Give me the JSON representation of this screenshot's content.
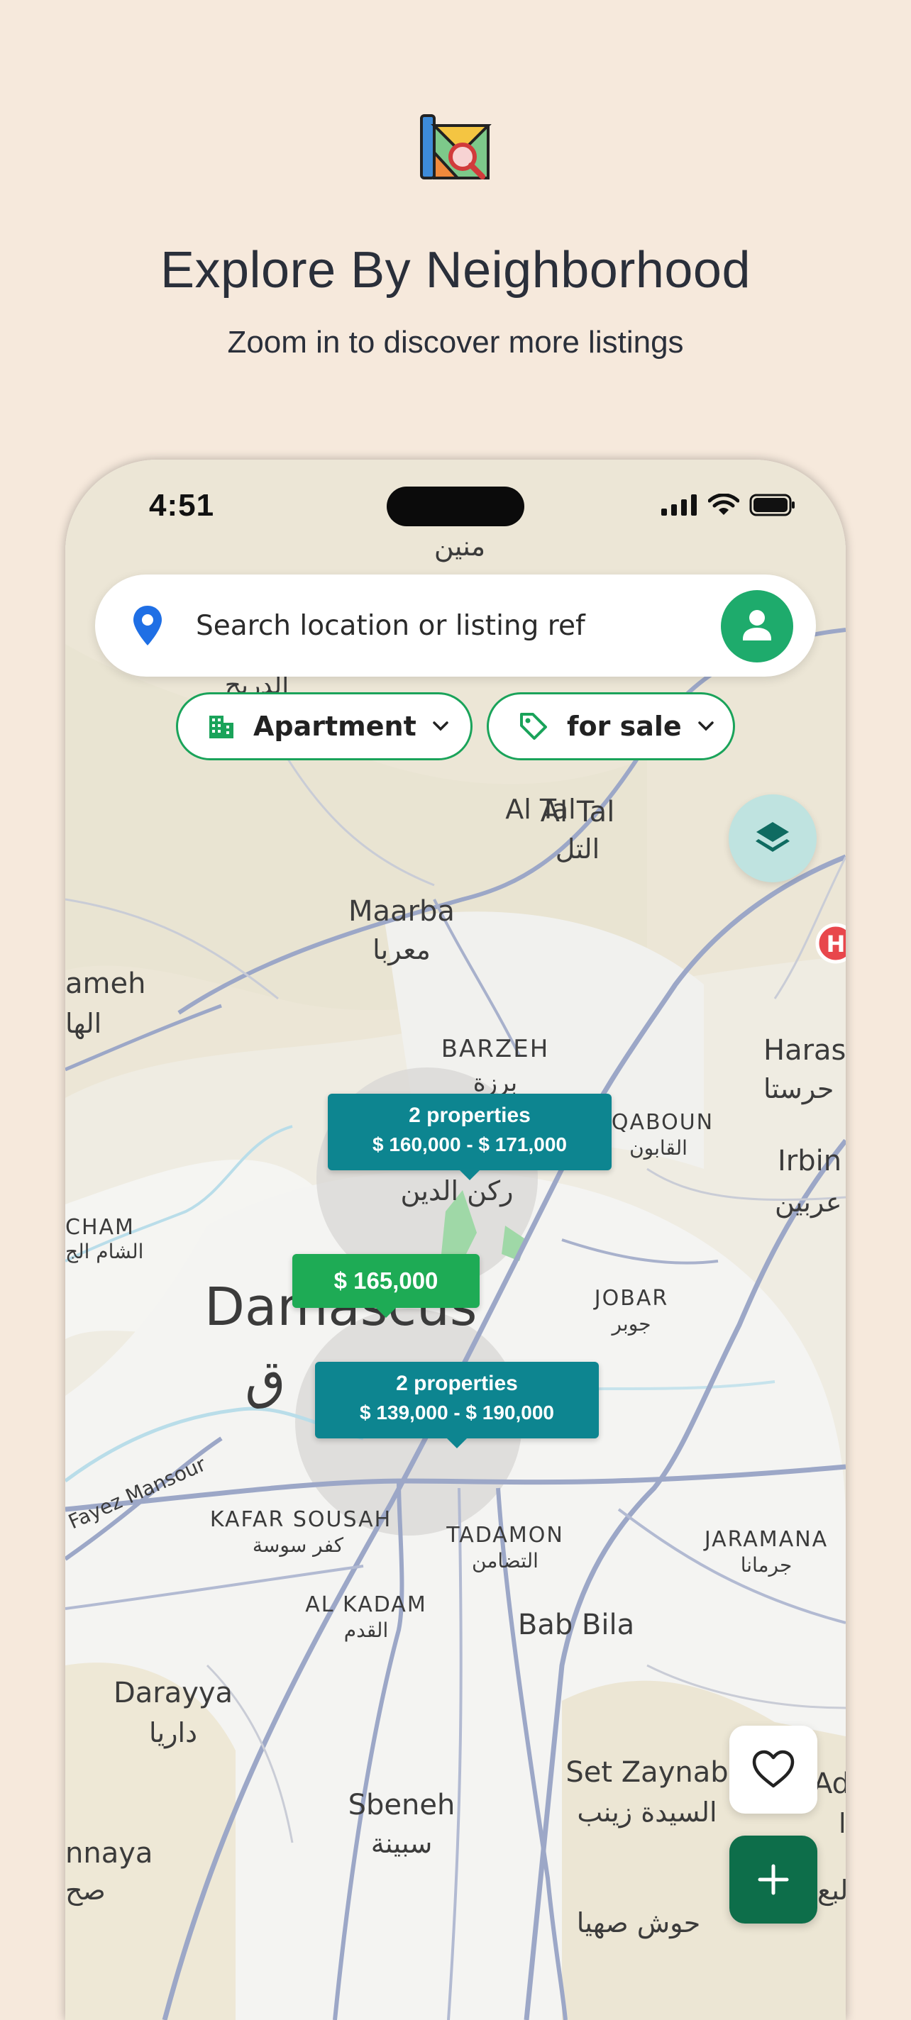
{
  "promo": {
    "icon": "map-search-icon",
    "title": "Explore By Neighborhood",
    "subtitle": "Zoom in to discover more listings"
  },
  "status_bar": {
    "time": "4:51",
    "icons": [
      "cellular-signal-icon",
      "wifi-icon",
      "battery-icon"
    ]
  },
  "search": {
    "placeholder": "Search location or listing ref",
    "icon": "location-pin-icon",
    "profile_icon": "user-icon"
  },
  "filters": {
    "property_type": {
      "label": "Apartment",
      "icon": "building-icon"
    },
    "listing_type": {
      "label": "for sale",
      "icon": "tag-icon"
    }
  },
  "map": {
    "labels": {
      "manin_ar": "منين",
      "al_tal_en": "Al Tal",
      "al_tal_ar": "التل",
      "maarba_en": "Maarba",
      "maarba_ar": "معربا",
      "hameh_en": "ameh",
      "hameh_ar": "الها",
      "barzeh_en": "BARZEH",
      "barzeh_ar": "برزة",
      "harasta_en": "Haras",
      "harasta_ar": "حرستا",
      "qaboun_en": "QABOUN",
      "qaboun_ar": "القابون",
      "irbin_en": "Irbin",
      "irbin_ar": "عربين",
      "rukn_ar": "ركن الدين",
      "sham_en": "CHAM",
      "sham_ar": "الشام الج",
      "damascus_en": "Damascus",
      "damascus_ar": "ق",
      "jobar_en": "JOBAR",
      "jobar_ar": "جوبر",
      "fayez_mansour": "Fayez Mansour",
      "kafar_sousah_en": "KAFAR SOUSAH",
      "kafar_sousah_ar": "كفر سوسة",
      "tadamon_en": "TADAMON",
      "tadamon_ar": "التضامن",
      "jaramana_en": "JARAMANA",
      "jaramana_ar": "جرمانا",
      "al_kadam_en": "AL KADAM",
      "al_kadam_ar": "القدم",
      "bab_bila": "Bab Bila",
      "darayya_en": "Darayya",
      "darayya_ar": "داريا",
      "set_zaynab_en": "Set Zaynab",
      "set_zaynab_ar": "السيدة زينب",
      "sbeneh_en": "Sbeneh",
      "sbeneh_ar": "سبينة",
      "sahnaya_en": "nnaya",
      "sahnaya_ar": "صح",
      "hosh_sahya_ar": "حوش صهيا",
      "dracham": "الدريج",
      "ad_en": "Ad",
      "ad_ar": "ا",
      "ad_ar2": "لبع",
      "hospital_marker": "H"
    },
    "markers": [
      {
        "count": "2 properties",
        "range": "$ 160,000 - $ 171,000"
      },
      {
        "price": "$ 165,000"
      },
      {
        "count": "2 properties",
        "range": "$ 139,000 - $ 190,000"
      }
    ]
  },
  "actions": {
    "layers_icon": "layers-icon",
    "favorite_icon": "heart-icon",
    "add_icon": "plus-icon"
  },
  "colors": {
    "background": "#f6e9dc",
    "accent_green": "#1eab6c",
    "cluster_teal": "#0d8590",
    "price_green": "#1eab55",
    "add_button": "#0d6e4a"
  }
}
